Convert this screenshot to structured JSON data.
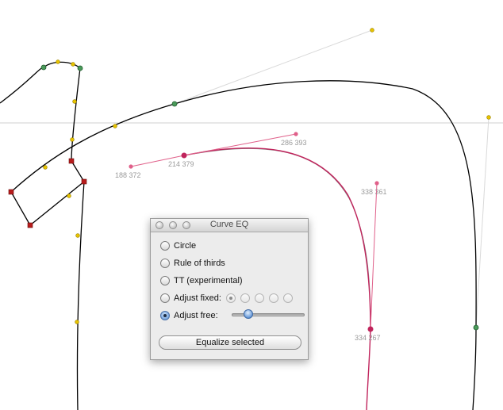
{
  "panel": {
    "title": "Curve EQ",
    "options": [
      {
        "label": "Circle",
        "selected": false
      },
      {
        "label": "Rule of thirds",
        "selected": false
      },
      {
        "label": "TT (experimental)",
        "selected": false
      },
      {
        "label": "Adjust fixed:",
        "selected": false
      },
      {
        "label": "Adjust free:",
        "selected": true
      }
    ],
    "fixed_choices": {
      "count": 5,
      "selected_index": 0
    },
    "free_slider_value": 0.22,
    "equalize_label": "Equalize selected"
  },
  "canvas": {
    "coords": [
      {
        "text": "286  393"
      },
      {
        "text": "188  372"
      },
      {
        "text": "214  379"
      },
      {
        "text": "338  361"
      },
      {
        "text": "334  267"
      }
    ],
    "colors": {
      "outline": "#000000",
      "selected_curve": "#c0245c",
      "handle_line": "#e0608a",
      "offcurve_point": "#e6c200",
      "oncurve_point": "#4a9a5a",
      "corner_point": "#b81c1c",
      "guide": "#cccccc"
    }
  }
}
